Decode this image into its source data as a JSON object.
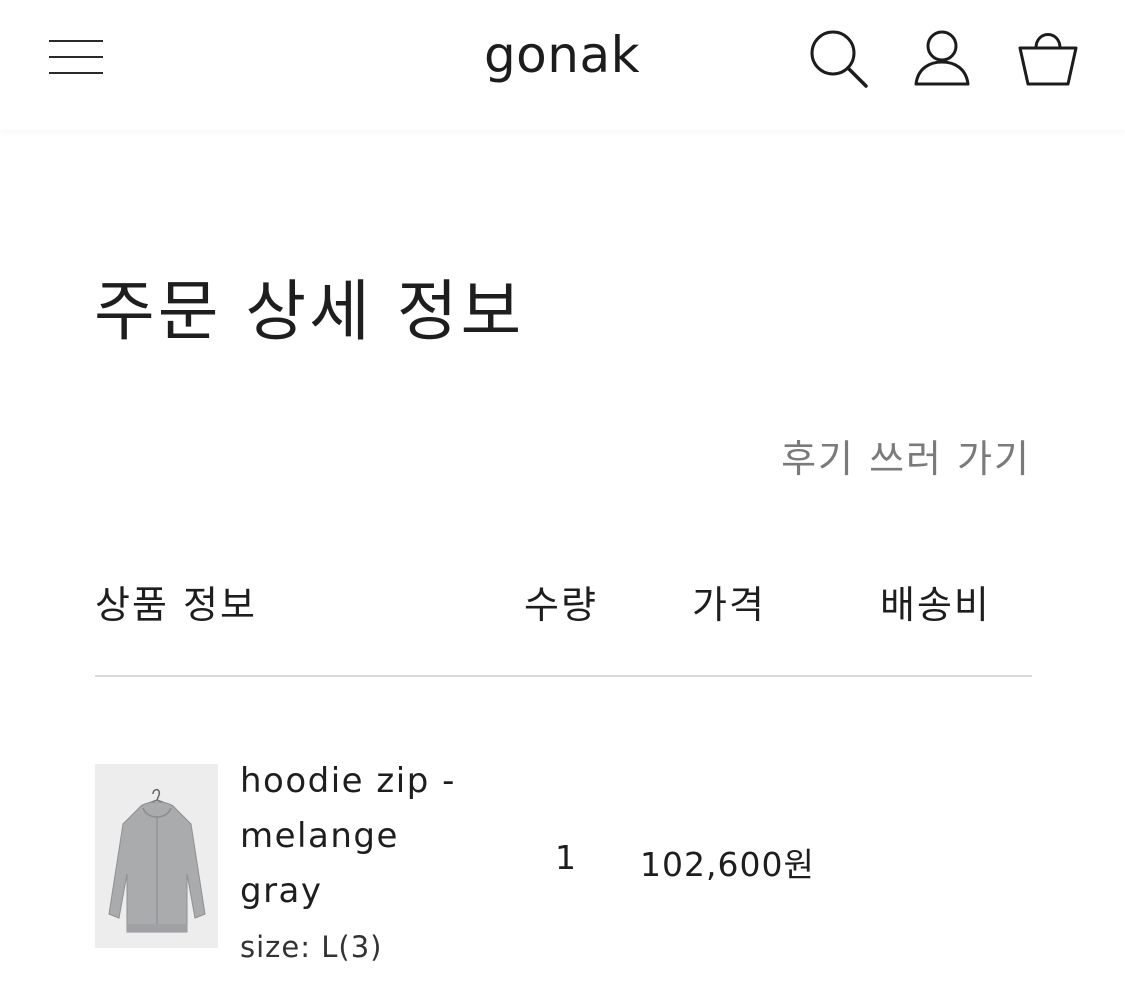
{
  "header": {
    "brand": "gonak",
    "icons": [
      "menu-icon",
      "search-icon",
      "user-icon",
      "shopping-bag-icon"
    ]
  },
  "page": {
    "title": "주문 상세 정보",
    "review_link": "후기 쓰러 가기"
  },
  "table": {
    "headers": {
      "product": "상품 정보",
      "quantity": "수량",
      "price": "가격",
      "shipping": "배송비"
    },
    "rows": [
      {
        "name": "hoodie zip - melange gray",
        "option": "size: L(3)",
        "quantity": "1",
        "price": "102,600원",
        "shipping": ""
      }
    ]
  },
  "colors": {
    "text": "#1e1e1e",
    "muted_text": "#7a7a7a",
    "divider": "#d9d9d9",
    "background": "#ffffff"
  }
}
